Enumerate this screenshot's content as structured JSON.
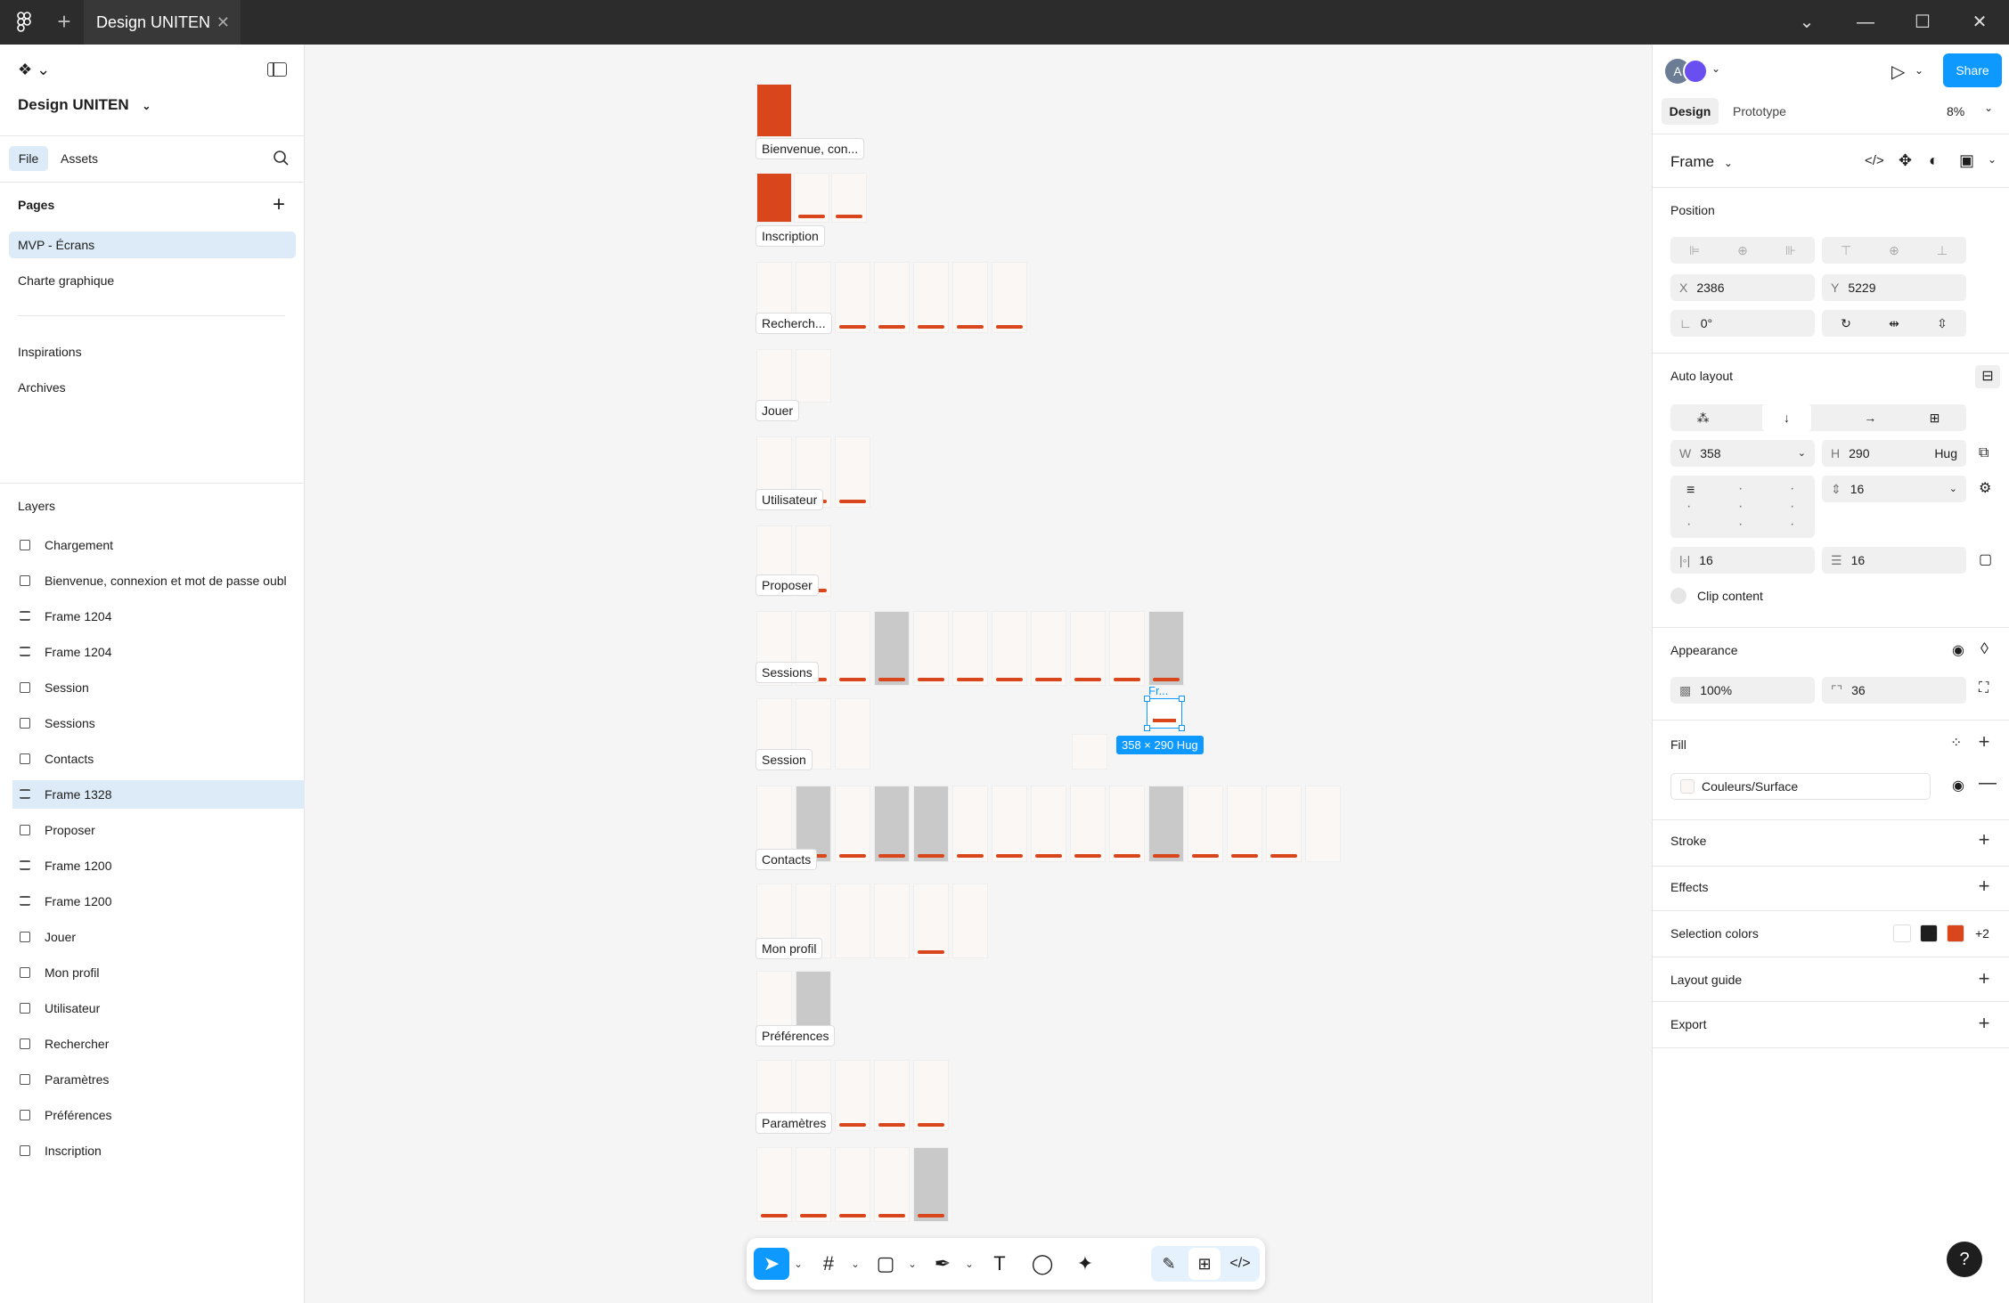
{
  "titlebar": {
    "tab_title": "Design UNITEN",
    "plus": "+",
    "close": "✕"
  },
  "left": {
    "file_name": "Design UNITEN",
    "tabs": {
      "file": "File",
      "assets": "Assets"
    },
    "pages_title": "Pages",
    "pages": [
      "MVP - Écrans",
      "Charte graphique",
      "Inspirations",
      "Archives"
    ],
    "layers_title": "Layers",
    "layers": [
      "Chargement",
      "Bienvenue, connexion et mot de passe oubl",
      "Frame 1204",
      "Frame 1204",
      "Session",
      "Sessions",
      "Contacts",
      "Frame 1328",
      "Proposer",
      "Frame 1200",
      "Frame 1200",
      "Jouer",
      "Mon profil",
      "Utilisateur",
      "Rechercher",
      "Paramètres",
      "Préférences",
      "Inscription"
    ]
  },
  "canvas": {
    "frame_labels": [
      "Bienvenue, con...",
      "Inscription",
      "Recherch...",
      "Jouer",
      "Utilisateur",
      "Proposer",
      "Sessions",
      "Session",
      "Contacts",
      "Mon profil",
      "Préférences",
      "Paramètres"
    ],
    "selection_label": "Fr...",
    "selection_size": "358 × 290 Hug"
  },
  "right": {
    "avatar_initial": "A",
    "share": "Share",
    "tabs": {
      "design": "Design",
      "prototype": "Prototype"
    },
    "zoom": "8%",
    "frame_type": "Frame",
    "position_title": "Position",
    "x_label": "X",
    "x": "2386",
    "y_label": "Y",
    "y": "5229",
    "rotation": "0°",
    "autolayout_title": "Auto layout",
    "w_label": "W",
    "w": "358",
    "h_label": "H",
    "h": "290",
    "h_mode": "Hug",
    "gap": "16",
    "pad_h": "16",
    "pad_v": "16",
    "clip": "Clip content",
    "appearance_title": "Appearance",
    "opacity": "100%",
    "radius": "36",
    "fill_title": "Fill",
    "fill_value": "Couleurs/Surface",
    "stroke_title": "Stroke",
    "effects_title": "Effects",
    "selection_colors_title": "Selection colors",
    "selection_colors": [
      "#ffffff",
      "#1e1e1e",
      "#d9461b"
    ],
    "selection_colors_more": "+2",
    "layout_guide_title": "Layout guide",
    "export_title": "Export"
  },
  "colors": {
    "accent": "#0d99ff",
    "brand": "#d9461b"
  }
}
